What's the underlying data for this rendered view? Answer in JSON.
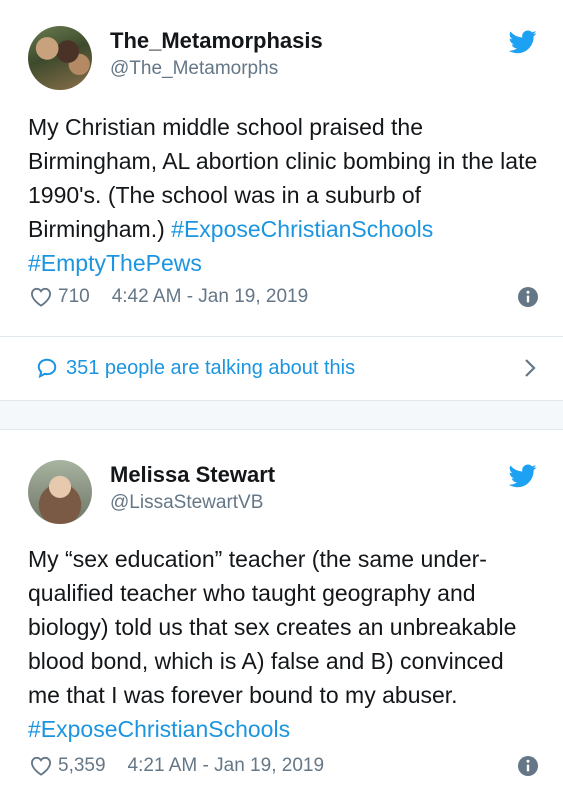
{
  "tweets": [
    {
      "author": "The_Metamorphasis",
      "handle": "@The_Metamorphs",
      "text_plain": "My Christian middle school praised the Birmingham, AL abortion clinic bombing in the late 1990's. (The school was in a suburb of Birmingham.) ",
      "hashtags": [
        "#ExposeChristianSchools",
        "#EmptyThePews"
      ],
      "likes": "710",
      "timestamp": "4:42 AM - Jan 19, 2019",
      "conversation": "351 people are talking about this"
    },
    {
      "author": "Melissa Stewart",
      "handle": "@LissaStewartVB",
      "text_plain": "My “sex education” teacher (the same under-qualified teacher who taught geography and biology) told us that sex creates an unbreakable blood bond, which is A) false and B) convinced me that I was forever bound to my abuser. ",
      "hashtags": [
        "#ExposeChristianSchools"
      ],
      "likes": "5,359",
      "timestamp": "4:21 AM - Jan 19, 2019"
    }
  ],
  "colors": {
    "link": "#1b95e0",
    "secondary_text": "#657786",
    "twitter_blue": "#1da1f2"
  },
  "icons": [
    "twitter-bird-icon",
    "heart-icon",
    "info-icon",
    "speech-bubble-icon",
    "chevron-right-icon"
  ]
}
